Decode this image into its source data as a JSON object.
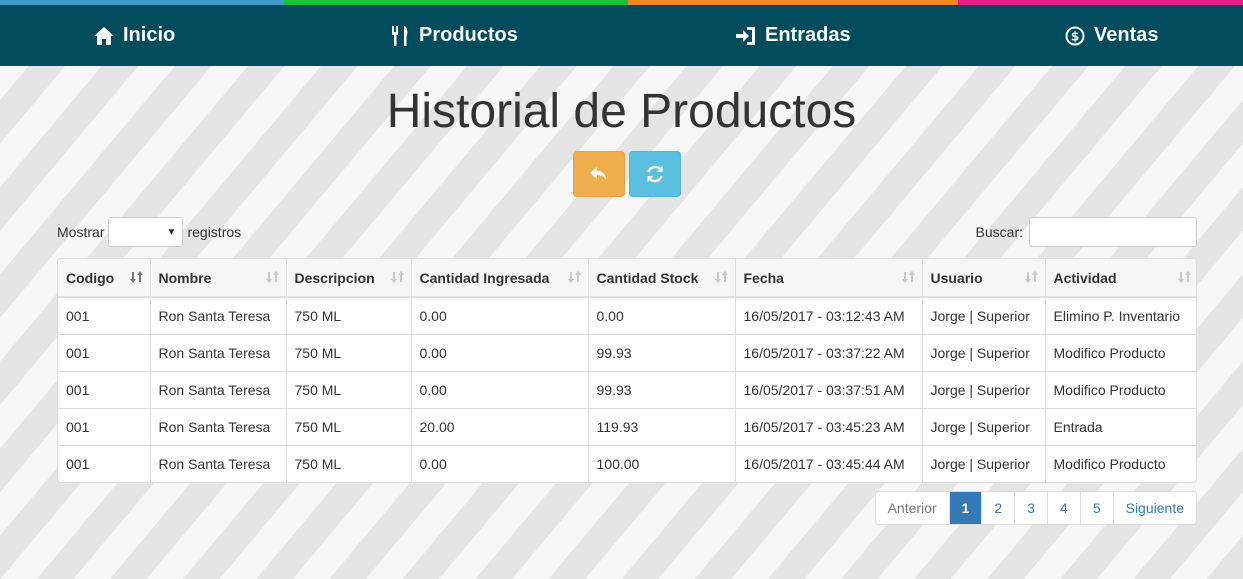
{
  "colors": {
    "nav_bg": "#004b5c",
    "stripe": [
      "#3e9bc8",
      "#19c13a",
      "#f08a1c",
      "#e91f87"
    ],
    "back_button": "#f0ad4e",
    "refresh_button": "#5bc0de",
    "active_page": "#337ab7"
  },
  "nav": {
    "items": [
      {
        "label": "Inicio",
        "icon": "home-icon"
      },
      {
        "label": "Productos",
        "icon": "utensils-icon"
      },
      {
        "label": "Entradas",
        "icon": "sign-in-icon"
      },
      {
        "label": "Ventas",
        "icon": "dollar-circle-icon"
      }
    ]
  },
  "page": {
    "title": "Historial de Productos"
  },
  "controls": {
    "back_icon": "reply-icon",
    "refresh_icon": "refresh-icon",
    "length_prefix": "Mostrar",
    "length_value": "",
    "length_suffix": "registros",
    "search_label": "Buscar:",
    "search_value": ""
  },
  "table": {
    "columns": [
      "Codigo",
      "Nombre",
      "Descripcion",
      "Cantidad Ingresada",
      "Cantidad Stock",
      "Fecha",
      "Usuario",
      "Actividad"
    ],
    "rows": [
      [
        "001",
        "Ron Santa Teresa",
        "750 ML",
        "0.00",
        "0.00",
        "16/05/2017 - 03:12:43 AM",
        "Jorge | Superior",
        "Elimino P. Inventario"
      ],
      [
        "001",
        "Ron Santa Teresa",
        "750 ML",
        "0.00",
        "99.93",
        "16/05/2017 - 03:37:22 AM",
        "Jorge | Superior",
        "Modifico Producto"
      ],
      [
        "001",
        "Ron Santa Teresa",
        "750 ML",
        "0.00",
        "99.93",
        "16/05/2017 - 03:37:51 AM",
        "Jorge | Superior",
        "Modifico Producto"
      ],
      [
        "001",
        "Ron Santa Teresa",
        "750 ML",
        "20.00",
        "119.93",
        "16/05/2017 - 03:45:23 AM",
        "Jorge | Superior",
        "Entrada"
      ],
      [
        "001",
        "Ron Santa Teresa",
        "750 ML",
        "0.00",
        "100.00",
        "16/05/2017 - 03:45:44 AM",
        "Jorge | Superior",
        "Modifico Producto"
      ]
    ]
  },
  "pagination": {
    "previous": "Anterior",
    "pages": [
      "1",
      "2",
      "3",
      "4",
      "5"
    ],
    "active_page": "1",
    "next": "Siguiente"
  }
}
